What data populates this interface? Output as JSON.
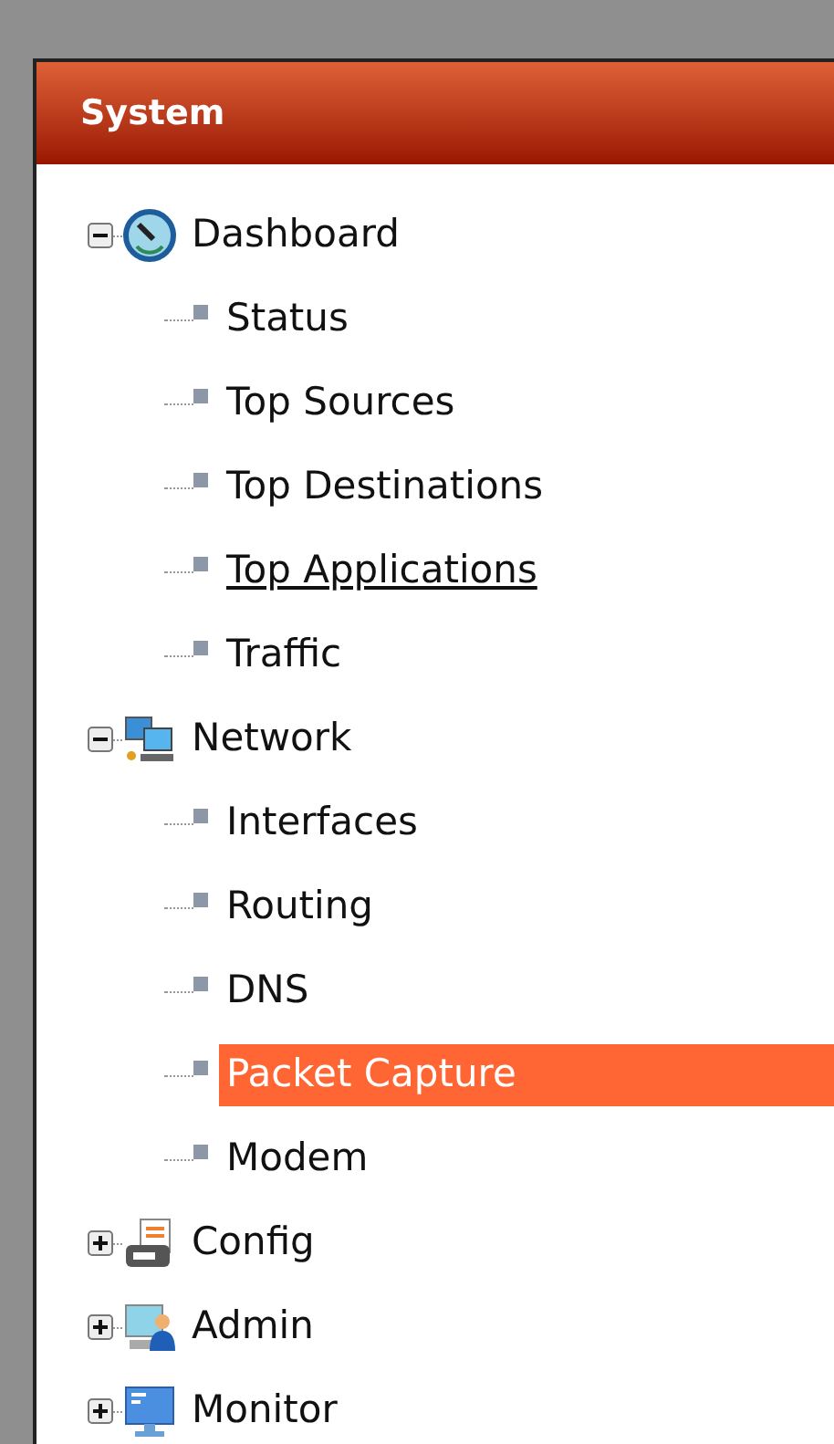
{
  "panel": {
    "title": "System"
  },
  "tree": [
    {
      "label": "Dashboard",
      "expanded": true,
      "children": [
        {
          "label": "Status",
          "selected": false,
          "hovered": false
        },
        {
          "label": "Top Sources",
          "selected": false,
          "hovered": false
        },
        {
          "label": "Top Destinations",
          "selected": false,
          "hovered": false
        },
        {
          "label": "Top Applications",
          "selected": false,
          "hovered": true
        },
        {
          "label": "Traffic",
          "selected": false,
          "hovered": false
        }
      ]
    },
    {
      "label": "Network",
      "expanded": true,
      "children": [
        {
          "label": "Interfaces",
          "selected": false,
          "hovered": false
        },
        {
          "label": "Routing",
          "selected": false,
          "hovered": false
        },
        {
          "label": "DNS",
          "selected": false,
          "hovered": false
        },
        {
          "label": "Packet Capture",
          "selected": true,
          "hovered": false
        },
        {
          "label": "Modem",
          "selected": false,
          "hovered": false
        }
      ]
    },
    {
      "label": "Config",
      "expanded": false
    },
    {
      "label": "Admin",
      "expanded": false
    },
    {
      "label": "Monitor",
      "expanded": false
    }
  ]
}
